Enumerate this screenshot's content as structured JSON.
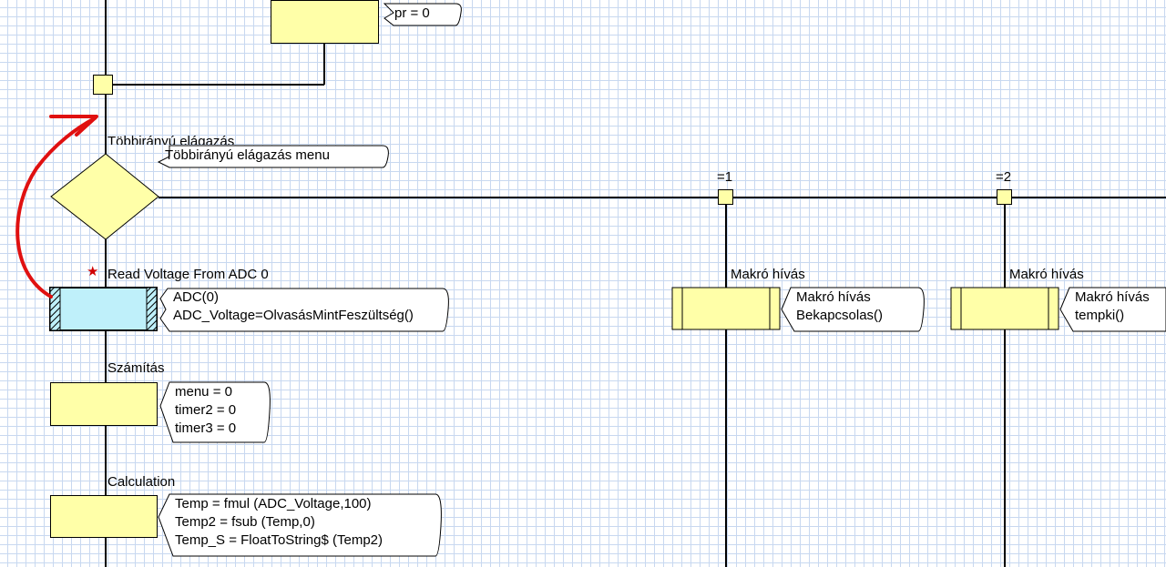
{
  "canvas": {
    "colors": {
      "block_fill": "#ffffa8",
      "adc_fill": "#bff0fa",
      "grid": "#c8d8f0",
      "line": "#000000",
      "arrow": "#e01010"
    }
  },
  "top_block": {
    "note_lines": [
      "pr = 0"
    ]
  },
  "switch": {
    "label": "Többirányú elágazás",
    "note_lines": [
      "Többirányú elágazás menu"
    ],
    "cases": [
      {
        "label": "=1"
      },
      {
        "label": "=2"
      }
    ]
  },
  "adc_block": {
    "label": "Read Voltage From ADC 0",
    "note_lines": [
      "ADC(0)",
      "ADC_Voltage=OlvasásMintFeszültség()"
    ],
    "marker": "★"
  },
  "calc_hu_block": {
    "label": "Számítás",
    "note_lines": [
      "menu = 0",
      "timer2 = 0",
      "timer3 = 0"
    ]
  },
  "calc_block": {
    "label": "Calculation",
    "note_lines": [
      "Temp = fmul (ADC_Voltage,100)",
      "Temp2 = fsub (Temp,0)",
      "Temp_S = FloatToString$ (Temp2)"
    ]
  },
  "macro1": {
    "label": "Makró hívás",
    "note_lines": [
      "Makró hívás",
      "Bekapcsolas()"
    ]
  },
  "macro2": {
    "label": "Makró hívás",
    "note_lines": [
      "Makró hívás",
      "tempki()"
    ]
  }
}
